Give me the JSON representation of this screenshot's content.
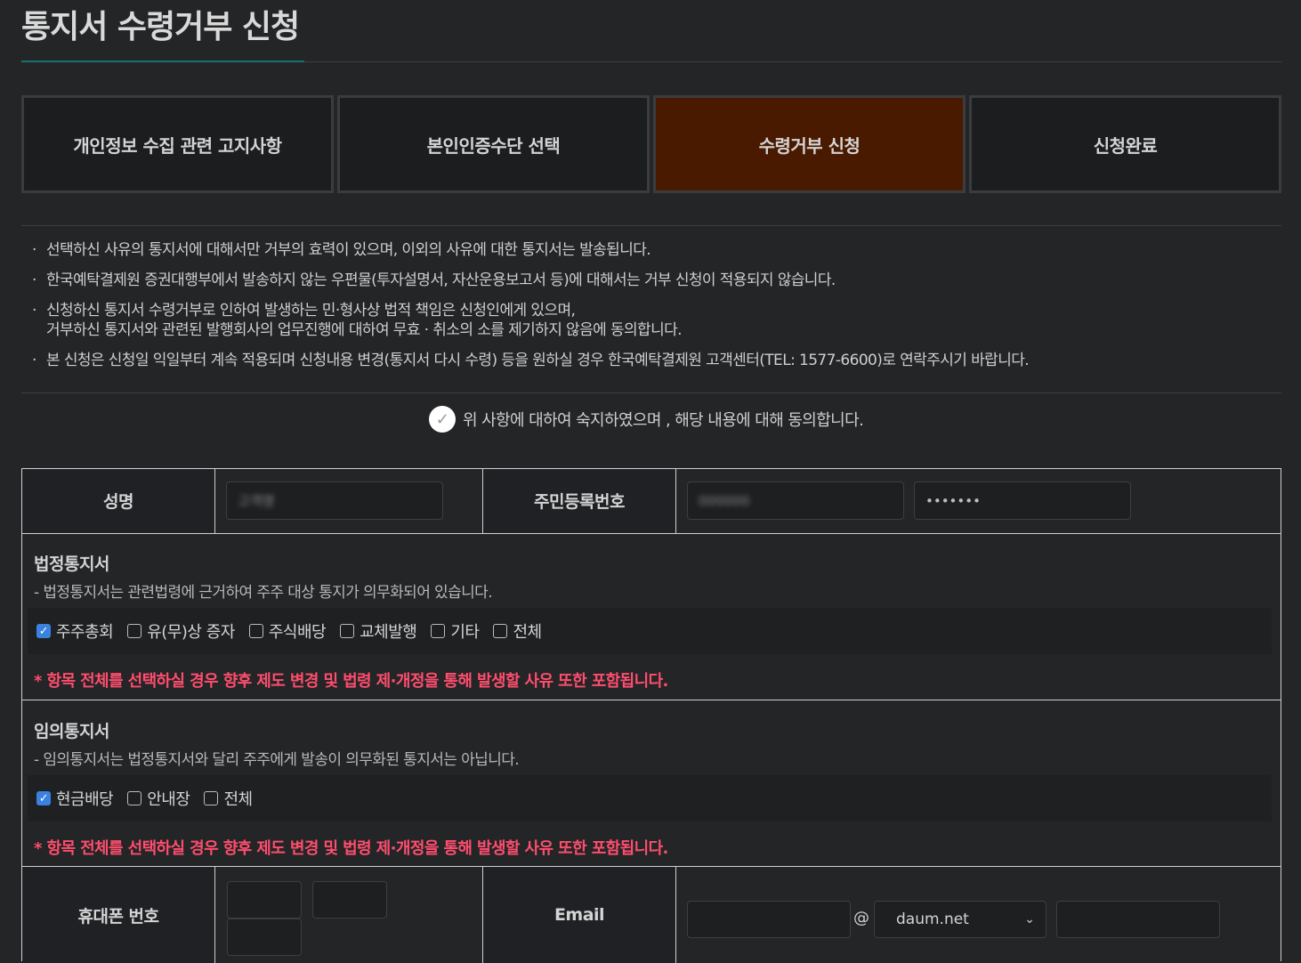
{
  "page": {
    "title": "통지서 수령거부 신청"
  },
  "steps": [
    {
      "label": "개인정보 수집 관련 고지사항",
      "active": false
    },
    {
      "label": "본인인증수단 선택",
      "active": false
    },
    {
      "label": "수령거부 신청",
      "active": true
    },
    {
      "label": "신청완료",
      "active": false
    }
  ],
  "notes": [
    "선택하신 사유의 통지서에 대해서만 거부의 효력이 있으며, 이외의 사유에 대한 통지서는 발송됩니다.",
    "한국예탁결제원 증권대행부에서 발송하지 않는 우편물(투자설명서, 자산운용보고서 등)에 대해서는 거부 신청이 적용되지 않습니다.",
    "신청하신 통지서 수령거부로 인하여 발생하는 민·형사상 법적 책임은 신청인에게 있으며,",
    "거부하신 통지서와 관련된 발행회사의 업무진행에 대하여 무효 · 취소의 소를 제기하지 않음에 동의합니다.",
    "본 신청은 신청일 익일부터 계속 적용되며 신청내용 변경(통지서 다시 수령) 등을 원하실 경우 한국예탁결제원 고객센터(TEL: 1577-6600)로 연락주시기 바랍니다."
  ],
  "agreement": {
    "text": "위 사항에 대하여 숙지하였으며 , 해당 내용에 대해 동의합니다.",
    "checked": true,
    "icon": "check-icon"
  },
  "form": {
    "name_label": "성명",
    "name_value": "고객명",
    "rrn_label": "주민등록번호",
    "rrn_front": "000000",
    "rrn_back": "•••••••",
    "legal": {
      "title": "법정통지서",
      "desc": "- 법정통지서는 관련법령에 근거하여 주주 대상 통지가 의무화되어 있습니다.",
      "options": [
        {
          "label": "주주총회",
          "checked": true
        },
        {
          "label": "유(무)상 증자",
          "checked": false
        },
        {
          "label": "주식배당",
          "checked": false
        },
        {
          "label": "교체발행",
          "checked": false
        },
        {
          "label": "기타",
          "checked": false
        },
        {
          "label": "전체",
          "checked": false
        }
      ],
      "warning": "* 항목 전체를 선택하실 경우 향후 제도 변경 및 법령 제·개정을 통해 발생할 사유 또한 포함됩니다."
    },
    "optional": {
      "title": "임의통지서",
      "desc": "- 임의통지서는 법정통지서와 달리 주주에게 발송이 의무화된 통지서는 아닙니다.",
      "options": [
        {
          "label": "현금배당",
          "checked": true
        },
        {
          "label": "안내장",
          "checked": false
        },
        {
          "label": "전체",
          "checked": false
        }
      ],
      "warning": "* 항목 전체를 선택하실 경우 향후 제도 변경 및 법령 제·개정을 통해 발생할 사유 또한 포함됩니다."
    },
    "phone_label": "휴대폰 번호",
    "email_label": "Email",
    "email_at": "@",
    "email_domain": "daum.net",
    "check_mark": "✓"
  },
  "colors": {
    "background": "#232527",
    "active_step": "#4a1a00",
    "warning": "#ff4d6d",
    "checkbox_on": "#3b82e0"
  }
}
